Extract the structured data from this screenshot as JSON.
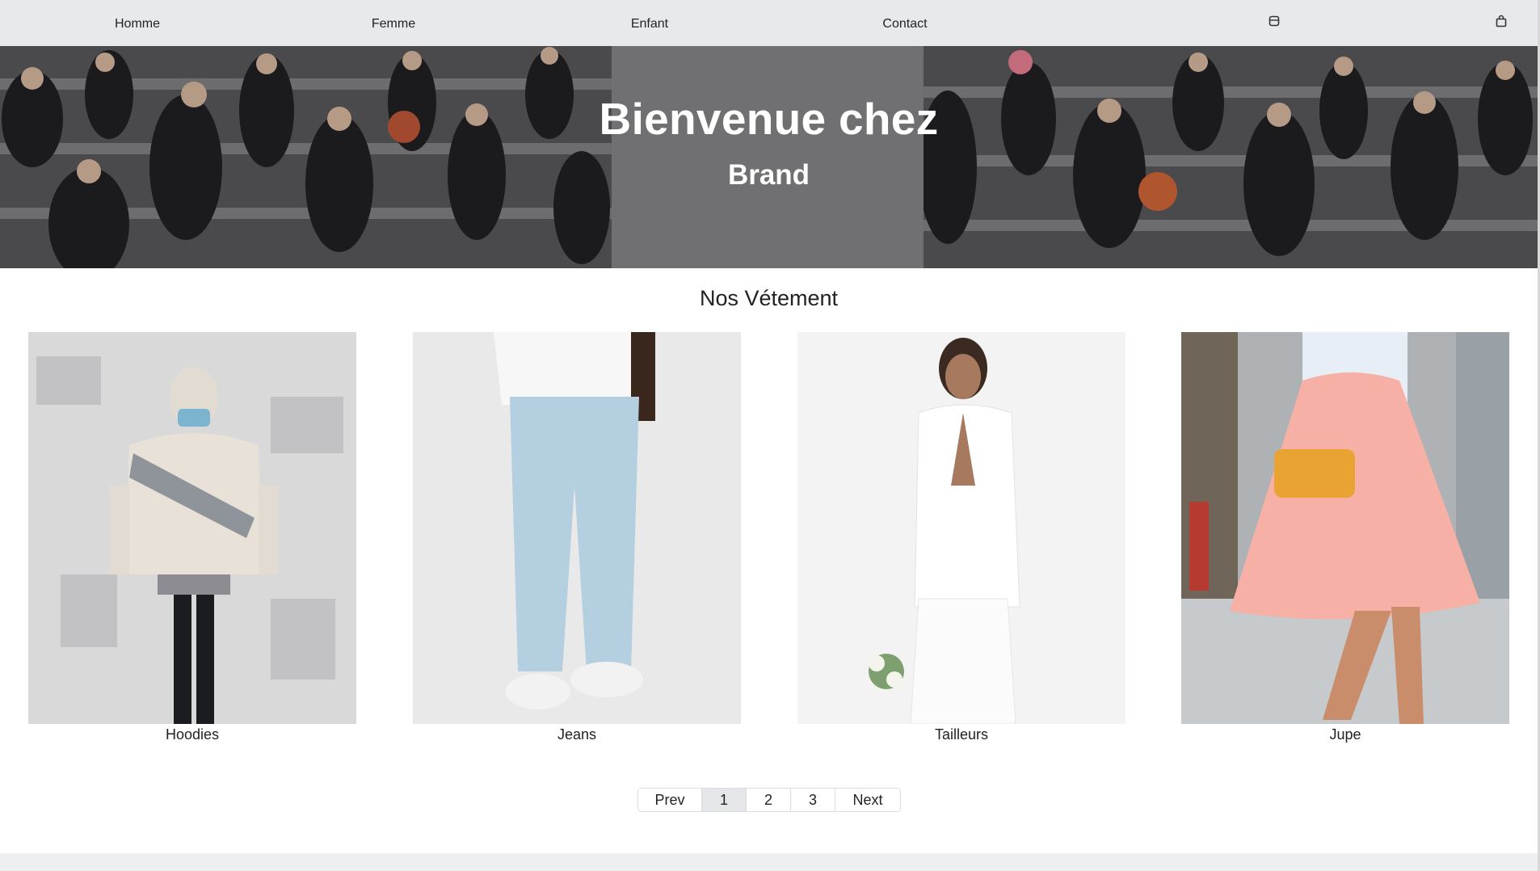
{
  "nav": {
    "links": [
      "Homme",
      "Femme",
      "Enfant",
      "Contact"
    ],
    "icons": [
      "box-icon",
      "shopping-bag-icon"
    ]
  },
  "hero": {
    "title": "Bienvenue chez",
    "subtitle": "Brand"
  },
  "section": {
    "title": "Nos Vétement"
  },
  "products": [
    {
      "label": "Hoodies",
      "image": "hoodie-photo"
    },
    {
      "label": "Jeans",
      "image": "jeans-photo"
    },
    {
      "label": "Tailleurs",
      "image": "suit-photo"
    },
    {
      "label": "Jupe",
      "image": "skirt-photo"
    }
  ],
  "pagination": {
    "prev": "Prev",
    "pages": [
      "1",
      "2",
      "3"
    ],
    "current": "1",
    "next": "Next"
  },
  "colors": {
    "nav_bg": "#e8e9ec",
    "hero_overlay": "#707072",
    "active_page": "#e4e6ea"
  }
}
